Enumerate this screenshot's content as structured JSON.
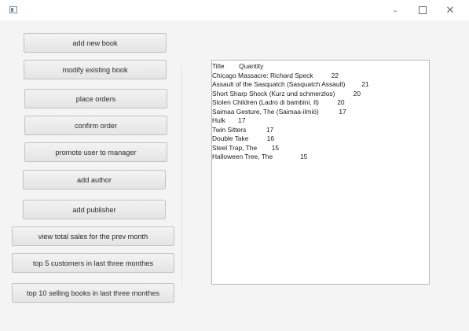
{
  "window": {
    "controls": {
      "minimize": "–",
      "maximize": "□",
      "close": "✕"
    }
  },
  "buttons": [
    {
      "id": "add-new-book",
      "label": "add new book"
    },
    {
      "id": "modify-existing-book",
      "label": "modify existing book"
    },
    {
      "id": "place-orders",
      "label": "place orders"
    },
    {
      "id": "confirm-order",
      "label": "confirm order"
    },
    {
      "id": "promote-user-to-manager",
      "label": "promote user to manager"
    },
    {
      "id": "add-author",
      "label": "add author"
    },
    {
      "id": "add-publisher",
      "label": "add publisher"
    },
    {
      "id": "view-total-sales",
      "label": "view total sales for the prev month"
    },
    {
      "id": "top-5-customers",
      "label": "top 5 customers in last three monthes"
    },
    {
      "id": "top-10-selling-books",
      "label": "top 10 selling books in last three monthes"
    }
  ],
  "output": {
    "lines": [
      "Title        Quantity",
      "Chicago Massacre: Richard Speck          22",
      "Assault of the Sasquatch (Sasquatch Assault)         21",
      "Short Sharp Shock (Kurz und schmerzlos)          20",
      "Stolen Children (Ladro di bambini, Il)          20",
      "Saimaa Gesture, The (Saimaa-ilmiö)           17",
      "Hulk       17",
      "Twin Sitters           17",
      "Double Take          16",
      "Steel Trap, The        15",
      "Halloween Tree, The               15"
    ]
  }
}
